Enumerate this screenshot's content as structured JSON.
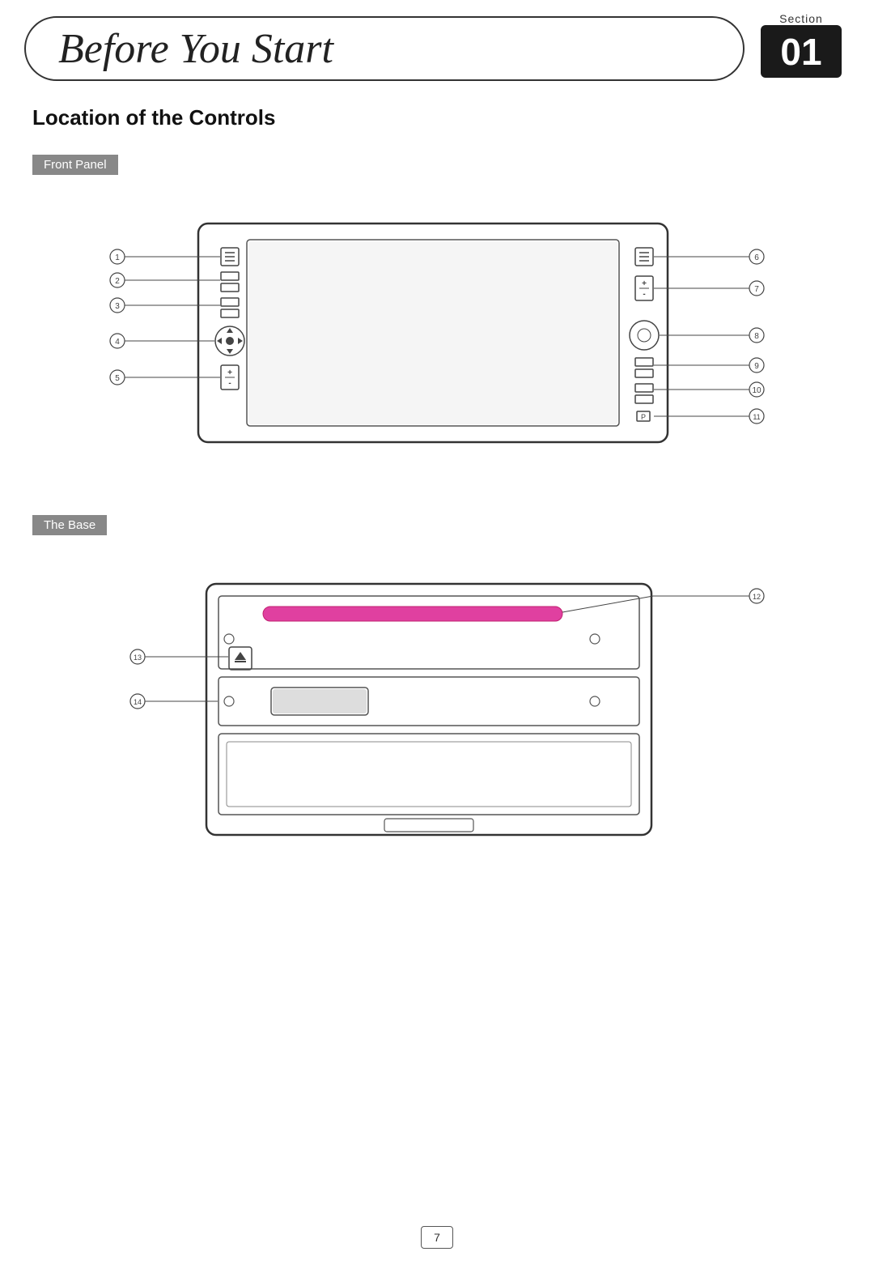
{
  "header": {
    "title": "Before You Start",
    "section_label": "Section",
    "section_number": "01"
  },
  "content": {
    "heading": "Location of the Controls",
    "front_panel_label": "Front Panel",
    "base_label": "The Base",
    "callouts_left": [
      "1",
      "2",
      "3",
      "4",
      "5"
    ],
    "callouts_right": [
      "6",
      "7",
      "8",
      "9",
      "10",
      "11"
    ],
    "callouts_base_right": [
      "12"
    ],
    "callouts_base_left": [
      "13",
      "14"
    ]
  },
  "page_number": "7"
}
